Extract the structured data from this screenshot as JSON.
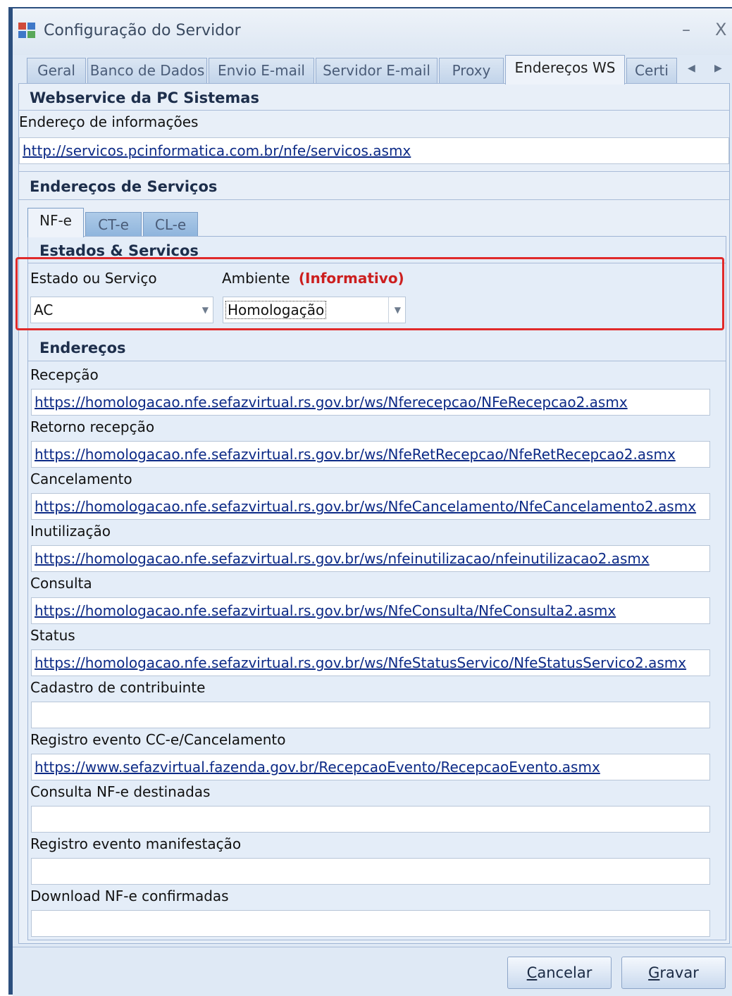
{
  "window": {
    "title": "Configuração do Servidor",
    "minimize": "–",
    "close": "X"
  },
  "tabs": [
    {
      "label": "Geral"
    },
    {
      "label": "Banco de Dados"
    },
    {
      "label": "Envio E-mail"
    },
    {
      "label": "Servidor E-mail"
    },
    {
      "label": "Proxy"
    },
    {
      "label": "Endereços WS",
      "active": true
    },
    {
      "label": "Certi"
    }
  ],
  "tab_scroll": {
    "left": "◀",
    "right": "▶"
  },
  "webservice": {
    "heading": "Webservice da PC Sistemas",
    "info_label": "Endereço de informações",
    "info_value": "http://servicos.pcinformatica.com.br/nfe/servicos.asmx"
  },
  "servicos": {
    "heading": "Endereços de Serviços",
    "subtabs": [
      "NF-e",
      "CT-e",
      "CL-e"
    ]
  },
  "estados": {
    "heading": "Estados & Servicos",
    "estado_label": "Estado ou Serviço",
    "estado_value": "AC",
    "ambiente_label": "Ambiente",
    "ambiente_note": "(Informativo)",
    "ambiente_value": "Homologação",
    "dropdown_arrow": "▼"
  },
  "enderecos": {
    "heading": "Endereços",
    "fields": [
      {
        "label": "Recepção",
        "value": "https://homologacao.nfe.sefazvirtual.rs.gov.br/ws/Nferecepcao/NFeRecepcao2.asmx"
      },
      {
        "label": "Retorno recepção",
        "value": "https://homologacao.nfe.sefazvirtual.rs.gov.br/ws/NfeRetRecepcao/NfeRetRecepcao2.asmx"
      },
      {
        "label": "Cancelamento",
        "value": "https://homologacao.nfe.sefazvirtual.rs.gov.br/ws/NfeCancelamento/NfeCancelamento2.asmx"
      },
      {
        "label": "Inutilização",
        "value": "https://homologacao.nfe.sefazvirtual.rs.gov.br/ws/nfeinutilizacao/nfeinutilizacao2.asmx"
      },
      {
        "label": "Consulta",
        "value": "https://homologacao.nfe.sefazvirtual.rs.gov.br/ws/NfeConsulta/NfeConsulta2.asmx"
      },
      {
        "label": "Status",
        "value": "https://homologacao.nfe.sefazvirtual.rs.gov.br/ws/NfeStatusServico/NfeStatusServico2.asmx"
      },
      {
        "label": "Cadastro de contribuinte",
        "value": ""
      },
      {
        "label": "Registro evento CC-e/Cancelamento",
        "value": "https://www.sefazvirtual.fazenda.gov.br/RecepcaoEvento/RecepcaoEvento.asmx"
      },
      {
        "label": "Consulta NF-e destinadas",
        "value": ""
      },
      {
        "label": "Registro evento manifestação",
        "value": ""
      },
      {
        "label": "Download NF-e confirmadas",
        "value": ""
      }
    ]
  },
  "buttons": {
    "cancel_accel": "C",
    "cancel_rest": "ancelar",
    "save_accel": "G",
    "save_rest": "ravar"
  },
  "colors": {
    "highlight": "#e02a2a",
    "note": "#cc1f1f",
    "link": "#0c2a86"
  }
}
